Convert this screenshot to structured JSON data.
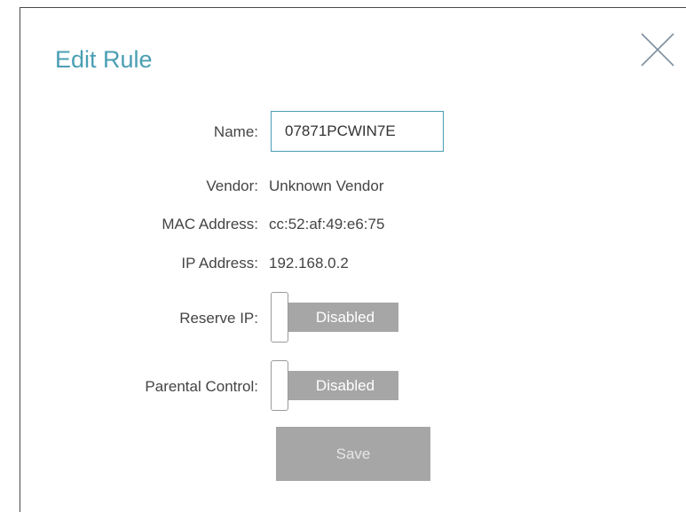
{
  "dialog": {
    "title": "Edit Rule",
    "close_icon": "close-icon"
  },
  "fields": {
    "name_label": "Name:",
    "name_value": "07871PCWIN7E",
    "vendor_label": "Vendor:",
    "vendor_value": "Unknown Vendor",
    "mac_label": "MAC Address:",
    "mac_value": "cc:52:af:49:e6:75",
    "ip_label": "IP Address:",
    "ip_value": "192.168.0.2",
    "reserve_ip_label": "Reserve IP:",
    "reserve_ip_state": "Disabled",
    "parental_label": "Parental Control:",
    "parental_state": "Disabled"
  },
  "actions": {
    "save_label": "Save"
  },
  "colors": {
    "accent": "#4a9fb3",
    "disabled": "#a6a6a6",
    "text": "#444444"
  }
}
